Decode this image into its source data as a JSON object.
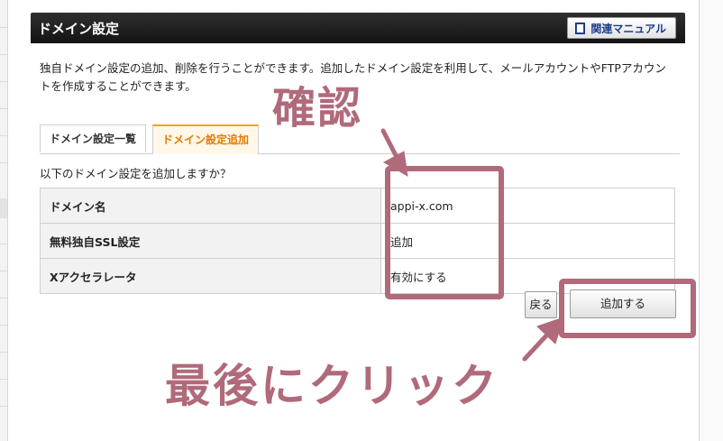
{
  "panel": {
    "title": "ドメイン設定",
    "manual_label": "関連マニュアル",
    "description": "独自ドメイン設定の追加、削除を行うことができます。追加したドメイン設定を利用して、メールアカウントやFTPアカウントを作成することができます。"
  },
  "tabs": [
    {
      "label": "ドメイン設定一覧",
      "active": false
    },
    {
      "label": "ドメイン設定追加",
      "active": true
    }
  ],
  "question": "以下のドメイン設定を追加しますか？",
  "rows": [
    {
      "key": "ドメイン名",
      "value": "appi-x.com"
    },
    {
      "key": "無料独自SSL設定",
      "value": "追加"
    },
    {
      "key": "Xアクセラレータ",
      "value": "有効にする"
    }
  ],
  "buttons": {
    "back": "戻る",
    "add": "追加する"
  },
  "annotations": {
    "confirm": "確認",
    "click_last": "最後にクリック",
    "color": "#b06a7a"
  },
  "colors": {
    "header_bg": "#1c1c1c",
    "active_tab": "#e27a00"
  }
}
